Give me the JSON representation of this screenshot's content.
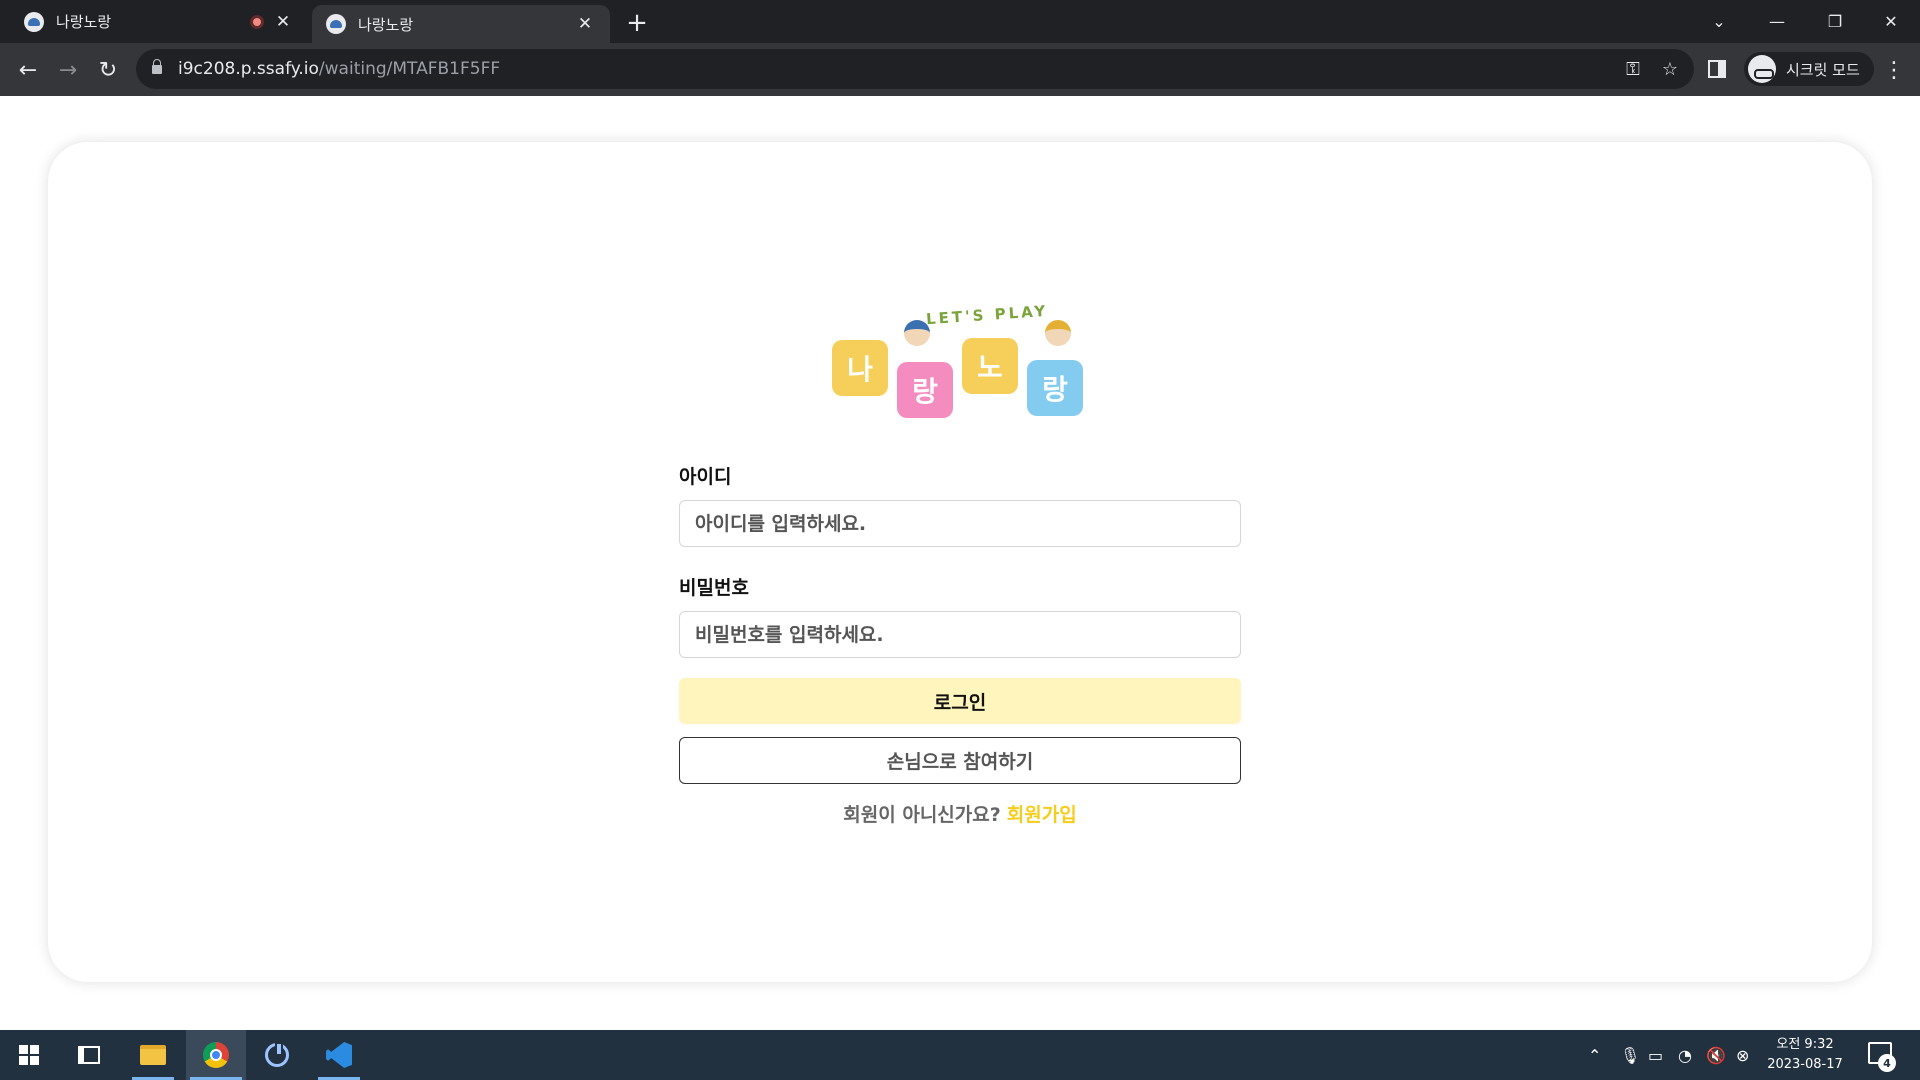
{
  "browser": {
    "tabs": [
      {
        "title": "나랑노랑",
        "recording": true
      },
      {
        "title": "나랑노랑",
        "active": true
      }
    ],
    "new_tab_icon": "plus-icon",
    "url_host": "i9c208.p.ssafy.io",
    "url_path": "/waiting/MTAFB1F5FF",
    "incognito_label": "시크릿 모드"
  },
  "logo": {
    "tagline": "LET'S PLAY",
    "tiles": [
      "나",
      "랑",
      "노",
      "랑"
    ],
    "colors": {
      "yellow": "#f5cf5a",
      "pink": "#f58cc0",
      "blue": "#83ccf0",
      "green": "#7aa33a"
    }
  },
  "form": {
    "id_label": "아이디",
    "id_placeholder": "아이디를 입력하세요.",
    "pw_label": "비밀번호",
    "pw_placeholder": "비밀번호를 입력하세요.",
    "login_button": "로그인",
    "guest_button": "손님으로 참여하기",
    "signup_prompt": "회원이 아니신가요?",
    "signup_link": "회원가입",
    "accent_color": "#f7cc1a",
    "login_bg": "#fff5bd"
  },
  "taskbar": {
    "time": "오전 9:32",
    "date": "2023-08-17",
    "notification_count": "4"
  }
}
